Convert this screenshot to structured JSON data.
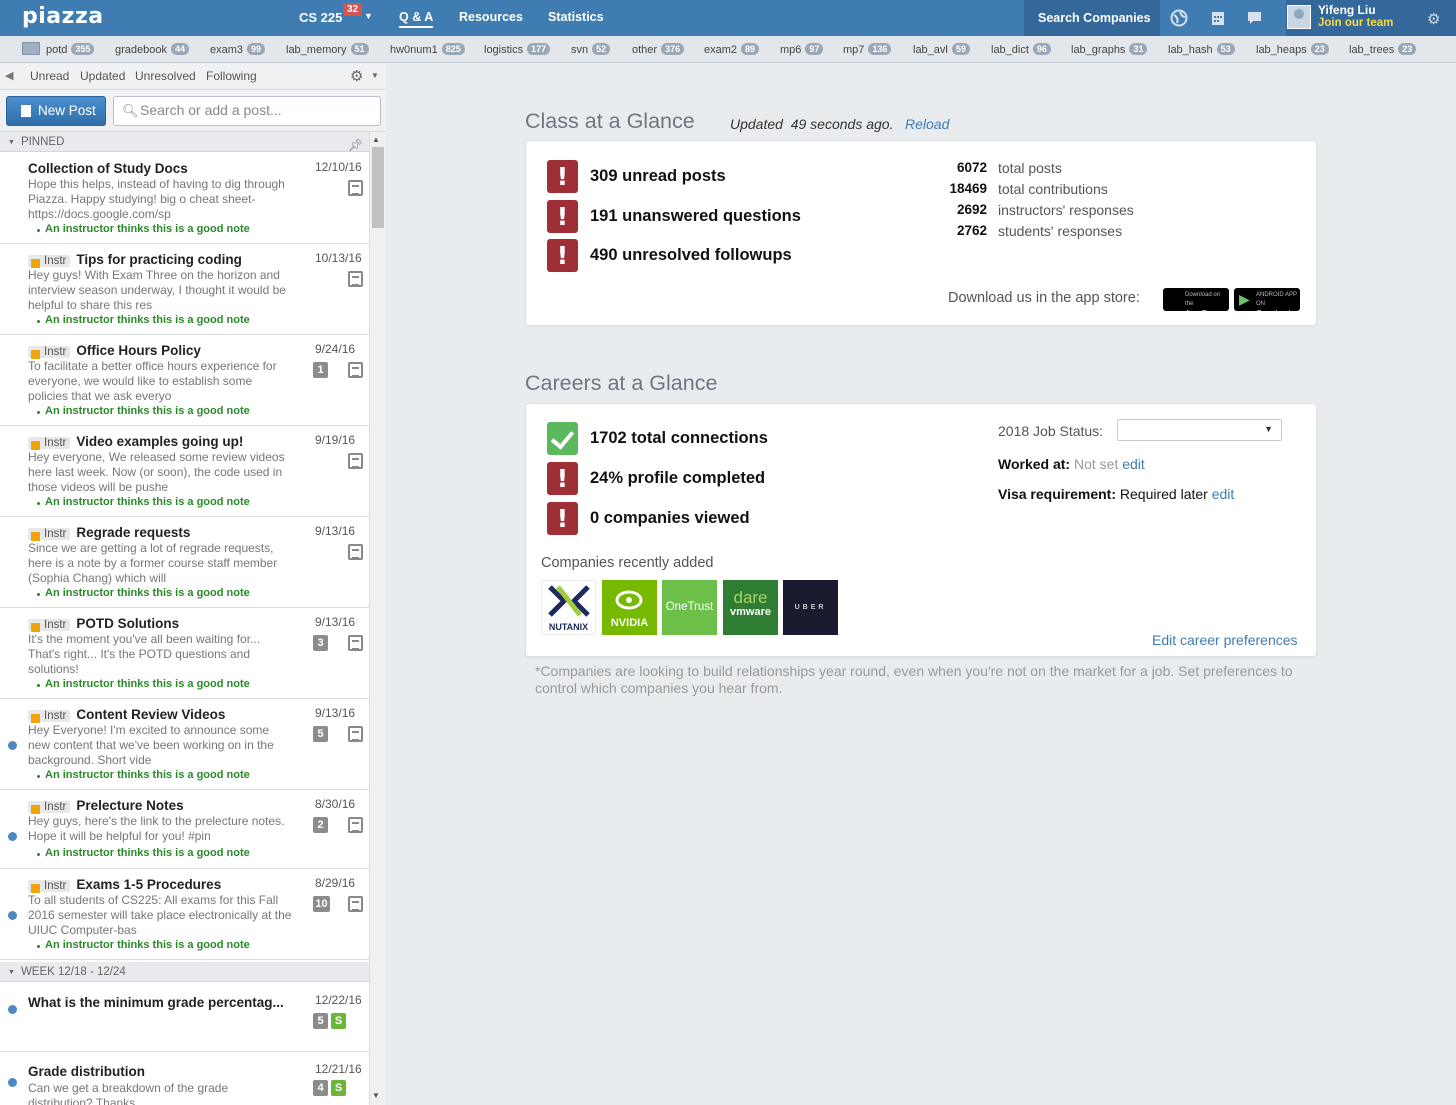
{
  "topbar": {
    "logo": "piazza",
    "course": "CS 225",
    "course_badge": "32",
    "nav": [
      "Q & A",
      "Resources",
      "Statistics"
    ],
    "search_companies": "Search Companies",
    "user_name": "Yifeng Liu",
    "user_sub": "Join our team"
  },
  "folders": [
    {
      "name": "potd",
      "count": "355"
    },
    {
      "name": "gradebook",
      "count": "44"
    },
    {
      "name": "exam3",
      "count": "99"
    },
    {
      "name": "lab_memory",
      "count": "51"
    },
    {
      "name": "hw0num1",
      "count": "825"
    },
    {
      "name": "logistics",
      "count": "177"
    },
    {
      "name": "svn",
      "count": "52"
    },
    {
      "name": "other",
      "count": "376"
    },
    {
      "name": "exam2",
      "count": "89"
    },
    {
      "name": "mp6",
      "count": "97"
    },
    {
      "name": "mp7",
      "count": "136"
    },
    {
      "name": "lab_avl",
      "count": "59"
    },
    {
      "name": "lab_dict",
      "count": "96"
    },
    {
      "name": "lab_graphs",
      "count": "31"
    },
    {
      "name": "lab_hash",
      "count": "53"
    },
    {
      "name": "lab_heaps",
      "count": "23"
    },
    {
      "name": "lab_trees",
      "count": "23"
    }
  ],
  "filters": [
    "Unread",
    "Updated",
    "Unresolved",
    "Following"
  ],
  "actions": {
    "new_post": "New Post",
    "search_placeholder": "Search or add a post..."
  },
  "groups": {
    "pinned": "PINNED",
    "week": "WEEK 12/18 - 12/24"
  },
  "instr_label": "Instr",
  "good_note": "An instructor thinks this is a good note",
  "posts": [
    {
      "title": "Collection of Study Docs",
      "date": "12/10/16",
      "excerpt": "Hope this helps, instead of having to dig through Piazza. Happy studying! big o cheat sheet- https://docs.google.com/sp",
      "instr": false,
      "count": "",
      "unread": false,
      "good": true
    },
    {
      "title": "Tips for practicing coding",
      "date": "10/13/16",
      "excerpt": "Hey guys! With Exam Three on the horizon and interview season underway, I thought it would be helpful to share this res",
      "instr": true,
      "count": "",
      "unread": false,
      "good": true
    },
    {
      "title": "Office Hours Policy",
      "date": "9/24/16",
      "excerpt": "To facilitate a better office hours experience for everyone, we would like to establish some policies that we ask everyo",
      "instr": true,
      "count": "1",
      "unread": false,
      "good": true
    },
    {
      "title": "Video examples going up!",
      "date": "9/19/16",
      "excerpt": "Hey everyone, We released some review videos here last week. Now (or soon), the code used in those videos will be pushe",
      "instr": true,
      "count": "",
      "unread": false,
      "good": true
    },
    {
      "title": "Regrade requests",
      "date": "9/13/16",
      "excerpt": "Since we are getting a lot of regrade requests, here is a note by a former course staff member (Sophia Chang) which will",
      "instr": true,
      "count": "",
      "unread": false,
      "good": true
    },
    {
      "title": "POTD Solutions",
      "date": "9/13/16",
      "excerpt": "It's the moment you've all been waiting for... That's right... It's the POTD questions and solutions!",
      "instr": true,
      "count": "3",
      "unread": false,
      "good": true
    },
    {
      "title": "Content Review Videos",
      "date": "9/13/16",
      "excerpt": "Hey Everyone! I'm excited to announce some new content that we've been working on in the background. Short vide",
      "instr": true,
      "count": "5",
      "unread": true,
      "good": true
    },
    {
      "title": "Prelecture Notes",
      "date": "8/30/16",
      "excerpt": "Hey guys, here's the link to the prelecture notes. Hope it will be helpful for you! #pin",
      "instr": true,
      "count": "2",
      "unread": true,
      "good": true
    },
    {
      "title": "Exams 1-5 Procedures",
      "date": "8/29/16",
      "excerpt": "To all students of CS225: All exams for this Fall 2016 semester will take place electronically at the UIUC Computer-bas",
      "instr": true,
      "count": "10",
      "unread": true,
      "good": true
    }
  ],
  "week_posts": [
    {
      "title": "What is the minimum grade percentag...",
      "date": "12/22/16",
      "excerpt": "",
      "count": "5",
      "s": "S",
      "unread": true
    },
    {
      "title": "Grade distribution",
      "date": "12/21/16",
      "excerpt": "Can we get a breakdown of the grade distribution? Thanks.",
      "count": "4",
      "s": "S",
      "unread": true
    }
  ],
  "class_glance": {
    "title": "Class at a Glance",
    "updated_prefix": "Updated",
    "updated_time": "49 seconds ago.",
    "reload": "Reload",
    "alerts": [
      "309 unread posts",
      "191 unanswered questions",
      "490 unresolved followups"
    ],
    "stats": [
      {
        "num": "6072",
        "label": "total posts"
      },
      {
        "num": "18469",
        "label": "total contributions"
      },
      {
        "num": "2692",
        "label": "instructors' responses"
      },
      {
        "num": "2762",
        "label": "students' responses"
      }
    ],
    "download_text": "Download us in the app store:",
    "app_store_top": "Download on the",
    "app_store": "App Store",
    "google_play_top": "ANDROID APP ON",
    "google_play": "Google play"
  },
  "careers": {
    "title": "Careers at a Glance",
    "items": [
      "1702 total connections",
      "24% profile completed",
      "0 companies viewed"
    ],
    "job_status_label": "2018 Job Status:",
    "worked_label": "Worked at:",
    "worked_value": "Not set",
    "visa_label": "Visa requirement:",
    "visa_value": "Required later",
    "edit": "edit",
    "companies_label": "Companies recently added",
    "companies": [
      "NUTANIX",
      "NVIDIA",
      "OneTrust",
      "vmware",
      "UBER"
    ],
    "edit_career": "Edit career preferences",
    "footnote": "*Companies are looking to build relationships year round, even when you're not on the market for a job. Set preferences to control which companies you hear from."
  }
}
